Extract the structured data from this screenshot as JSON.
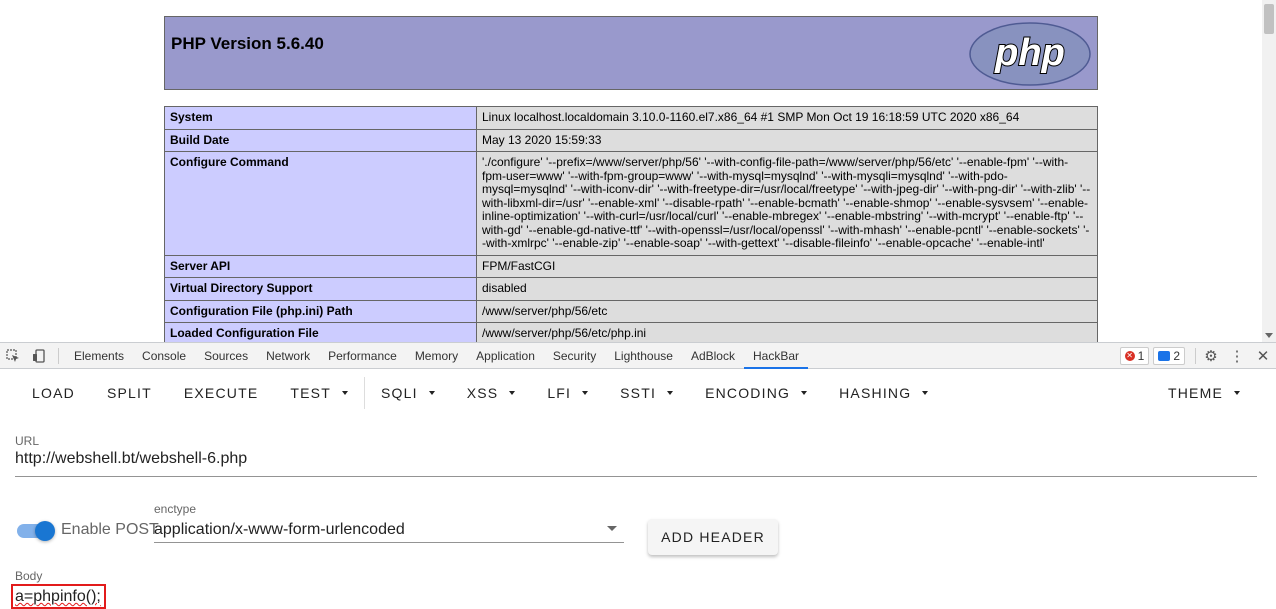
{
  "phpinfo": {
    "title": "PHP Version 5.6.40",
    "logo_text": "php",
    "rows": [
      {
        "key": "System",
        "value": "Linux localhost.localdomain 3.10.0-1160.el7.x86_64 #1 SMP Mon Oct 19 16:18:59 UTC 2020 x86_64"
      },
      {
        "key": "Build Date",
        "value": "May 13 2020 15:59:33"
      },
      {
        "key": "Configure Command",
        "value": "'./configure' '--prefix=/www/server/php/56' '--with-config-file-path=/www/server/php/56/etc' '--enable-fpm' '--with-fpm-user=www' '--with-fpm-group=www' '--with-mysql=mysqlnd' '--with-mysqli=mysqlnd' '--with-pdo-mysql=mysqlnd' '--with-iconv-dir' '--with-freetype-dir=/usr/local/freetype' '--with-jpeg-dir' '--with-png-dir' '--with-zlib' '--with-libxml-dir=/usr' '--enable-xml' '--disable-rpath' '--enable-bcmath' '--enable-shmop' '--enable-sysvsem' '--enable-inline-optimization' '--with-curl=/usr/local/curl' '--enable-mbregex' '--enable-mbstring' '--with-mcrypt' '--enable-ftp' '--with-gd' '--enable-gd-native-ttf' '--with-openssl=/usr/local/openssl' '--with-mhash' '--enable-pcntl' '--enable-sockets' '--with-xmlrpc' '--enable-zip' '--enable-soap' '--with-gettext' '--disable-fileinfo' '--enable-opcache' '--enable-intl'"
      },
      {
        "key": "Server API",
        "value": "FPM/FastCGI"
      },
      {
        "key": "Virtual Directory Support",
        "value": "disabled"
      },
      {
        "key": "Configuration File (php.ini) Path",
        "value": "/www/server/php/56/etc"
      },
      {
        "key": "Loaded Configuration File",
        "value": "/www/server/php/56/etc/php.ini"
      }
    ]
  },
  "devtools": {
    "tabs": [
      "Elements",
      "Console",
      "Sources",
      "Network",
      "Performance",
      "Memory",
      "Application",
      "Security",
      "Lighthouse",
      "AdBlock",
      "HackBar"
    ],
    "active_tab": "HackBar",
    "error_count": "1",
    "message_count": "2",
    "icons": [
      "inspect-icon",
      "device-toggle-icon",
      "settings-icon",
      "more-options-icon",
      "close-icon"
    ]
  },
  "hackbar": {
    "buttons": [
      {
        "label": "LOAD",
        "dropdown": false
      },
      {
        "label": "SPLIT",
        "dropdown": false
      },
      {
        "label": "EXECUTE",
        "dropdown": false
      },
      {
        "label": "TEST",
        "dropdown": true
      },
      {
        "label": "SQLI",
        "dropdown": true
      },
      {
        "label": "XSS",
        "dropdown": true
      },
      {
        "label": "LFI",
        "dropdown": true
      },
      {
        "label": "SSTI",
        "dropdown": true
      },
      {
        "label": "ENCODING",
        "dropdown": true
      },
      {
        "label": "HASHING",
        "dropdown": true
      }
    ],
    "theme_label": "THEME",
    "url_label": "URL",
    "url_value": "http://webshell.bt/webshell-6.php",
    "post_toggle_label": "Enable POST",
    "post_enabled": true,
    "enctype_label": "enctype",
    "enctype_value": "application/x-www-form-urlencoded",
    "add_header_label": "ADD HEADER",
    "body_label": "Body",
    "body_value": "a=phpinfo();",
    "colors": {
      "php_header": "#9999cc",
      "key_cell": "#ccccff",
      "value_cell": "#dddddd",
      "toggle_accent": "#1976d2",
      "highlight_box": "#e21b1b",
      "active_tab_underline": "#1a73e8"
    }
  }
}
